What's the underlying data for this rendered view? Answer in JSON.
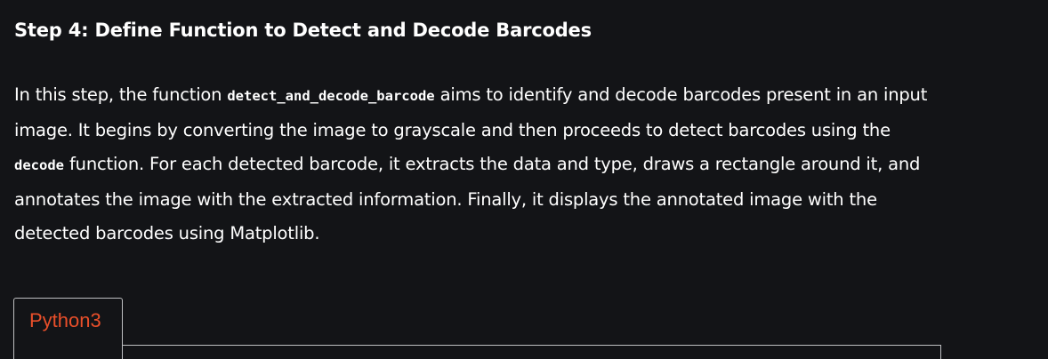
{
  "step": {
    "heading": "Step 4: Define Function to Detect and Decode Barcodes"
  },
  "paragraph": {
    "text_1": "In this step, the function ",
    "code_1": "detect_and_decode_barcode",
    "text_2": " aims to identify and decode barcodes present in an input image. It begins by converting the image to grayscale and then proceeds to detect barcodes using the ",
    "code_2": "decode",
    "text_3": " function. For each detected barcode, it extracts the data and type, draws a rectangle around it, and annotates the image with the extracted information. Finally, it displays the annotated image with the detected barcodes using Matplotlib."
  },
  "code_tabs": [
    {
      "label": "Python3"
    }
  ],
  "colors": {
    "background": "#131417",
    "text": "#ffffff",
    "tab_label": "#e94f2a",
    "border": "#bfc0c2"
  }
}
